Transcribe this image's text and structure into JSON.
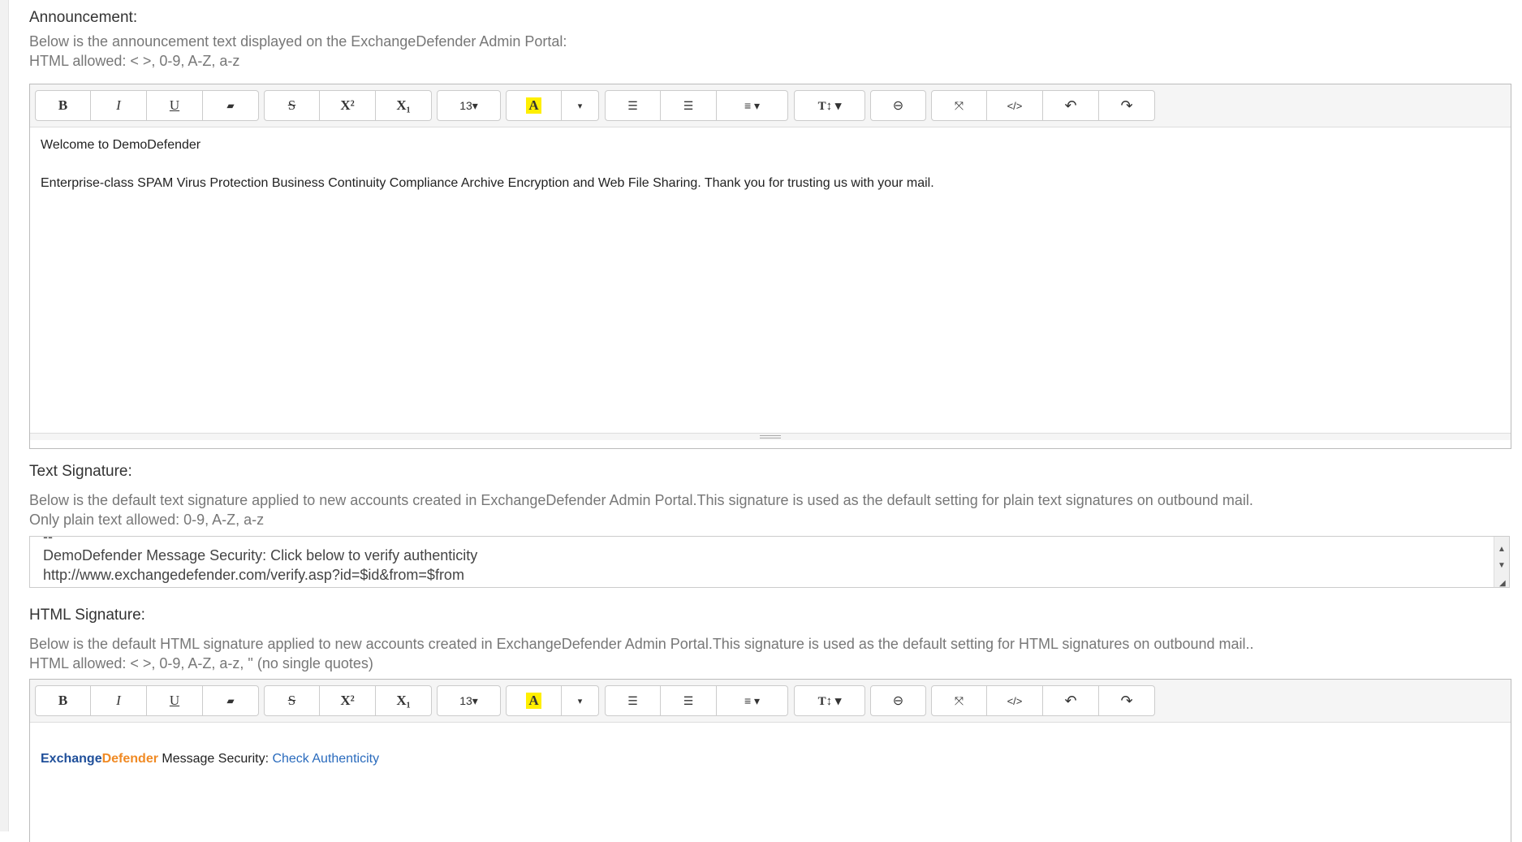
{
  "announcement": {
    "label": "Announcement:",
    "help_line1": "Below is the announcement text displayed on the ExchangeDefender Admin Portal:",
    "help_line2": "HTML allowed: < >, 0-9, A-Z, a-z",
    "content_line1": "Welcome to DemoDefender",
    "content_line2": "Enterprise-class SPAM Virus Protection Business Continuity Compliance Archive Encryption and Web File Sharing. Thank you for trusting us with your mail."
  },
  "toolbar": {
    "bold": "B",
    "italic": "I",
    "underline": "U",
    "eraser": "▰",
    "strike": "S",
    "superscript": "X²",
    "subscript": "X₁",
    "font_size": "13▾",
    "color": "A",
    "color_caret": "▾",
    "bullets": "☰",
    "numbers": "☰",
    "align": "≡ ▾",
    "line_height": "T↕ ▾",
    "link": "⊖",
    "fullscreen": "⤧",
    "code": "</>",
    "undo": "↶",
    "redo": "↷"
  },
  "text_signature": {
    "label": "Text Signature:",
    "help_line1": "Below is the default text signature applied to new accounts created in ExchangeDefender Admin Portal.This signature is used as the default setting for plain text signatures on outbound mail.",
    "help_line2": "Only plain text allowed: 0-9, A-Z, a-z",
    "value_line0": "--",
    "value_line1": "DemoDefender Message Security: Click below to verify authenticity",
    "value_line2": "http://www.exchangedefender.com/verify.asp?id=$id&from=$from"
  },
  "html_signature": {
    "label": "HTML Signature:",
    "help_line1": "Below is the default HTML signature applied to new accounts created in ExchangeDefender Admin Portal.This signature is used as the default setting for HTML signatures on outbound mail..",
    "help_line2": "HTML allowed: < >, 0-9, A-Z, a-z, \" (no single quotes)",
    "brand_part1": "Exchange",
    "brand_part2": "Defender",
    "text": " Message Security: ",
    "link": "Check Authenticity"
  }
}
